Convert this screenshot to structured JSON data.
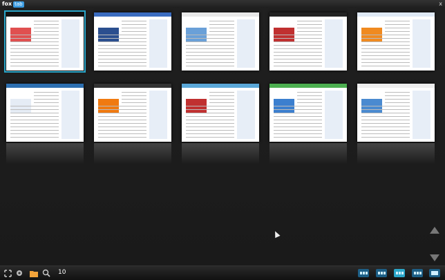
{
  "app": {
    "logo_text": "fox",
    "logo_badge": "tab",
    "close_label": "x"
  },
  "thumbnails": [
    {
      "name": "page-thumb-1",
      "selected": true,
      "header_color": "#111111",
      "accent": "#e05050"
    },
    {
      "name": "page-thumb-2",
      "selected": false,
      "header_color": "#3a6cc0",
      "accent": "#2b4f8f"
    },
    {
      "name": "page-thumb-3",
      "selected": false,
      "header_color": "#e8e8e8",
      "accent": "#6aa0d8"
    },
    {
      "name": "page-thumb-4",
      "selected": false,
      "header_color": "#222222",
      "accent": "#c03030"
    },
    {
      "name": "page-thumb-5",
      "selected": false,
      "header_color": "#dfe9f5",
      "accent": "#f08a20"
    },
    {
      "name": "page-thumb-6",
      "selected": false,
      "header_color": "#2d6fb0",
      "accent": "#e5ecf5"
    },
    {
      "name": "page-thumb-7",
      "selected": false,
      "header_color": "#333333",
      "accent": "#f07a10"
    },
    {
      "name": "page-thumb-8",
      "selected": false,
      "header_color": "#5aa7d8",
      "accent": "#c03030"
    },
    {
      "name": "page-thumb-9",
      "selected": false,
      "header_color": "#4caf50",
      "accent": "#3b7fcf"
    },
    {
      "name": "page-thumb-10",
      "selected": false,
      "header_color": "#eeeeee",
      "accent": "#4a8ad0"
    }
  ],
  "bottombar": {
    "tab_count": "10",
    "icons": [
      "fullscreen-icon",
      "gear-icon",
      "folder-icon",
      "search-icon"
    ]
  }
}
